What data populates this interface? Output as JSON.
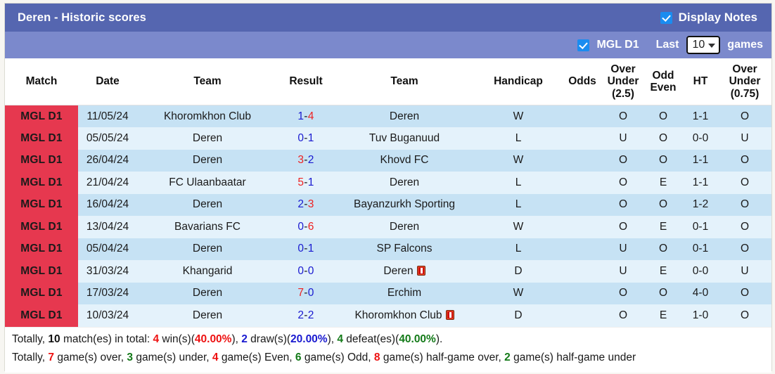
{
  "header": {
    "title": "Deren - Historic scores",
    "display_notes_label": "Display Notes",
    "display_notes_checked": true,
    "league_filter_label": "MGL D1",
    "league_filter_checked": true,
    "last_label": "Last",
    "games_label": "games",
    "games_count": "10",
    "accent_header": "#5566b0",
    "accent_subheader": "#7b89cc",
    "accent_badge": "#e6384f"
  },
  "table": {
    "columns": [
      "Match",
      "Date",
      "Team",
      "Result",
      "Team",
      "Handicap",
      "Odds",
      "Over Under (2.5)",
      "Odd Even",
      "HT",
      "Over Under (0.75)"
    ],
    "columns_multiline": {
      "over_under_25": [
        "Over",
        "Under",
        "(2.5)"
      ],
      "odd_even": [
        "Odd",
        "Even"
      ],
      "over_under_075": [
        "Over",
        "Under",
        "(0.75)"
      ]
    },
    "rows": [
      {
        "league": "MGL D1",
        "date": "11/05/24",
        "home": "Khoromkhon Club",
        "home_color": "dark",
        "home_card": false,
        "result_home": "1",
        "result_home_color": "blue",
        "result_away": "4",
        "result_away_color": "red",
        "away": "Deren",
        "away_color": "red",
        "away_card": false,
        "handicap": "W",
        "handicap_color": "red",
        "odds": "",
        "ou25": "O",
        "ou25_color": "red",
        "oddeven": "O",
        "oddeven_color": "green",
        "ht": "1-1",
        "ou075": "O",
        "ou075_color": "red"
      },
      {
        "league": "MGL D1",
        "date": "05/05/24",
        "home": "Deren",
        "home_color": "green",
        "home_card": false,
        "result_home": "0",
        "result_home_color": "blue",
        "result_away": "1",
        "result_away_color": "blue",
        "away": "Tuv Buganuud",
        "away_color": "dark",
        "away_card": false,
        "handicap": "L",
        "handicap_color": "green",
        "odds": "",
        "ou25": "U",
        "ou25_color": "green",
        "oddeven": "O",
        "oddeven_color": "green",
        "ht": "0-0",
        "ou075": "U",
        "ou075_color": "green"
      },
      {
        "league": "MGL D1",
        "date": "26/04/24",
        "home": "Deren",
        "home_color": "red",
        "home_card": false,
        "result_home": "3",
        "result_home_color": "red",
        "result_away": "2",
        "result_away_color": "blue",
        "away": "Khovd FC",
        "away_color": "dark",
        "away_card": false,
        "handicap": "W",
        "handicap_color": "red",
        "odds": "",
        "ou25": "O",
        "ou25_color": "red",
        "oddeven": "O",
        "oddeven_color": "green",
        "ht": "1-1",
        "ou075": "O",
        "ou075_color": "red"
      },
      {
        "league": "MGL D1",
        "date": "21/04/24",
        "home": "FC Ulaanbaatar",
        "home_color": "dark",
        "home_card": false,
        "result_home": "5",
        "result_home_color": "red",
        "result_away": "1",
        "result_away_color": "blue",
        "away": "Deren",
        "away_color": "green",
        "away_card": false,
        "handicap": "L",
        "handicap_color": "green",
        "odds": "",
        "ou25": "O",
        "ou25_color": "red",
        "oddeven": "E",
        "oddeven_color": "red",
        "ht": "1-1",
        "ou075": "O",
        "ou075_color": "red"
      },
      {
        "league": "MGL D1",
        "date": "16/04/24",
        "home": "Deren",
        "home_color": "green",
        "home_card": false,
        "result_home": "2",
        "result_home_color": "blue",
        "result_away": "3",
        "result_away_color": "red",
        "away": "Bayanzurkh Sporting",
        "away_color": "dark",
        "away_card": false,
        "handicap": "L",
        "handicap_color": "green",
        "odds": "",
        "ou25": "O",
        "ou25_color": "red",
        "oddeven": "O",
        "oddeven_color": "green",
        "ht": "1-2",
        "ou075": "O",
        "ou075_color": "red"
      },
      {
        "league": "MGL D1",
        "date": "13/04/24",
        "home": "Bavarians FC",
        "home_color": "dark",
        "home_card": false,
        "result_home": "0",
        "result_home_color": "blue",
        "result_away": "6",
        "result_away_color": "red",
        "away": "Deren",
        "away_color": "red",
        "away_card": false,
        "handicap": "W",
        "handicap_color": "red",
        "odds": "",
        "ou25": "O",
        "ou25_color": "red",
        "oddeven": "E",
        "oddeven_color": "red",
        "ht": "0-1",
        "ou075": "O",
        "ou075_color": "red"
      },
      {
        "league": "MGL D1",
        "date": "05/04/24",
        "home": "Deren",
        "home_color": "green",
        "home_card": false,
        "result_home": "0",
        "result_home_color": "blue",
        "result_away": "1",
        "result_away_color": "blue",
        "away": "SP Falcons",
        "away_color": "dark",
        "away_card": false,
        "handicap": "L",
        "handicap_color": "green",
        "odds": "",
        "ou25": "U",
        "ou25_color": "green",
        "oddeven": "O",
        "oddeven_color": "green",
        "ht": "0-1",
        "ou075": "O",
        "ou075_color": "red"
      },
      {
        "league": "MGL D1",
        "date": "31/03/24",
        "home": "Khangarid",
        "home_color": "dark",
        "home_card": false,
        "result_home": "0",
        "result_home_color": "blue",
        "result_away": "0",
        "result_away_color": "blue",
        "away": "Deren",
        "away_color": "blue",
        "away_card": true,
        "handicap": "D",
        "handicap_color": "blue",
        "odds": "",
        "ou25": "U",
        "ou25_color": "green",
        "oddeven": "E",
        "oddeven_color": "red",
        "ht": "0-0",
        "ou075": "U",
        "ou075_color": "green"
      },
      {
        "league": "MGL D1",
        "date": "17/03/24",
        "home": "Deren",
        "home_color": "red",
        "home_card": false,
        "result_home": "7",
        "result_home_color": "red",
        "result_away": "0",
        "result_away_color": "blue",
        "away": "Erchim",
        "away_color": "dark",
        "away_card": false,
        "handicap": "W",
        "handicap_color": "red",
        "odds": "",
        "ou25": "O",
        "ou25_color": "red",
        "oddeven": "O",
        "oddeven_color": "green",
        "ht": "4-0",
        "ou075": "O",
        "ou075_color": "red"
      },
      {
        "league": "MGL D1",
        "date": "10/03/24",
        "home": "Deren",
        "home_color": "blue",
        "home_card": false,
        "result_home": "2",
        "result_home_color": "blue",
        "result_away": "2",
        "result_away_color": "blue",
        "away": "Khoromkhon Club",
        "away_color": "dark",
        "away_card": true,
        "handicap": "D",
        "handicap_color": "blue",
        "odds": "",
        "ou25": "O",
        "ou25_color": "red",
        "oddeven": "E",
        "oddeven_color": "red",
        "ht": "1-0",
        "ou075": "O",
        "ou075_color": "red"
      }
    ]
  },
  "summary": {
    "line1": {
      "prefix": "Totally, ",
      "total": "10",
      "mid1": " match(es) in total: ",
      "wins": "4",
      "mid2": " win(s)(",
      "wins_pct": "40.00%",
      "mid3": "), ",
      "draws": "2",
      "mid4": " draw(s)(",
      "draws_pct": "20.00%",
      "mid5": "), ",
      "defeats": "4",
      "mid6": " defeat(es)(",
      "defeats_pct": "40.00%",
      "suffix": ")."
    },
    "line2": {
      "prefix": "Totally, ",
      "over": "7",
      "mid1": " game(s) over, ",
      "under": "3",
      "mid2": " game(s) under, ",
      "even": "4",
      "mid3": " game(s) Even, ",
      "odd": "6",
      "mid4": " game(s) Odd, ",
      "half_over": "8",
      "mid5": " game(s) half-game over, ",
      "half_under": "2",
      "suffix": " game(s) half-game under"
    }
  }
}
